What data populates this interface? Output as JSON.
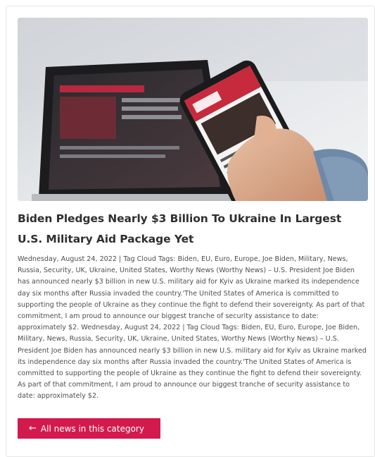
{
  "article": {
    "image_icon": "phone-news-photo",
    "title": "Biden Pledges Nearly $3 Billion To Ukraine In Largest U.S. Military Aid Package Yet",
    "excerpt": "Wednesday, August 24, 2022 | Tag Cloud Tags: Biden, EU, Euro, Europe, Joe Biden, Military, News, Russia, Security, UK, Ukraine, United States, Worthy News (Worthy News) – U.S. President Joe Biden has announced nearly $3 billion in new U.S. military aid for Kyiv as Ukraine marked its independence day six months after Russia invaded the country.'The United States of America is committed to supporting the people of Ukraine as they continue the fight to defend their sovereignty. As part of that commitment, I am proud to announce our biggest tranche of security assistance to date: approximately $2. Wednesday, August 24, 2022 | Tag Cloud Tags: Biden, EU, Euro, Europe, Joe Biden, Military, News, Russia, Security, UK, Ukraine, United States, Worthy News (Worthy News) – U.S. President Joe Biden has announced nearly $3 billion in new U.S. military aid for Kyiv as Ukraine marked its independence day six months after Russia invaded the country.'The United States of America is committed to supporting the people of Ukraine as they continue the fight to defend their sovereignty. As part of that commitment, I am proud to announce our biggest tranche of security assistance to date: approximately $2."
  },
  "actions": {
    "all_news_label": "All news in this category",
    "arrow_icon": "arrow-left-icon"
  },
  "colors": {
    "accent": "#d31a4d",
    "title": "#2f2f2f",
    "text": "#4e4e4e"
  }
}
